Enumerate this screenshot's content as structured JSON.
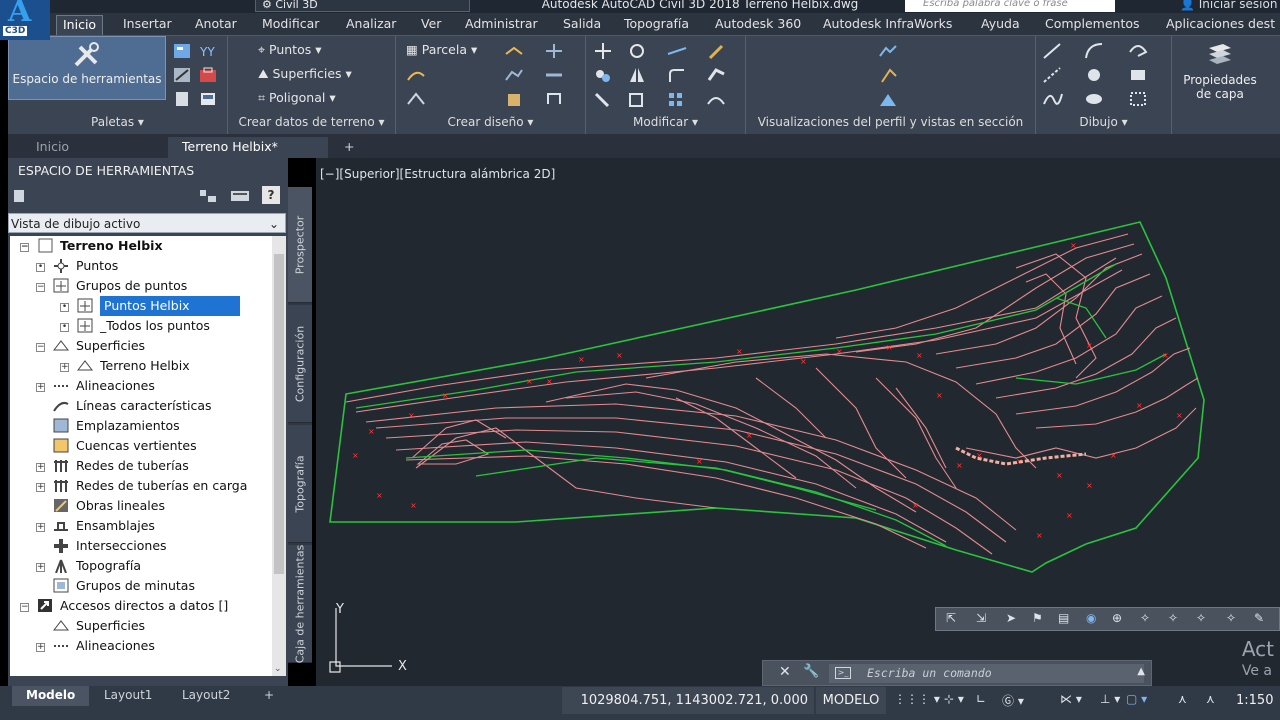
{
  "titlebar": {
    "workspace": "Civil 3D",
    "title": "Autodesk AutoCAD Civil 3D 2018     Terreno Helbix.dwg",
    "search_placeholder": "Escriba palabra clave o frase",
    "signin": "Iniciar sesión"
  },
  "app_badge": "C3D",
  "menu_tabs": [
    "Inicio",
    "Insertar",
    "Anotar",
    "Modificar",
    "Analizar",
    "Ver",
    "Administrar",
    "Salida",
    "Topografía",
    "Autodesk 360",
    "Autodesk InfraWorks",
    "Ayuda",
    "Complementos",
    "Aplicaciones dest"
  ],
  "ribbon": {
    "paletas": {
      "big_label": "Espacio de herramientas",
      "title": "Paletas"
    },
    "crear_datos": {
      "puntos": "Puntos",
      "superficies": "Superficies",
      "poligonal": "Poligonal",
      "title": "Crear datos de terreno"
    },
    "crear_diseno": {
      "parcela": "Parcela",
      "title": "Crear diseño"
    },
    "modificar": {
      "title": "Modificar"
    },
    "perfil": {
      "title": "Visualizaciones del perfil y vistas en sección"
    },
    "dibujo": {
      "title": "Dibujo"
    },
    "capas": {
      "label_1": "Propiedades",
      "label_2": "de capa"
    }
  },
  "doc_tabs": [
    "Inicio",
    "Terreno Helbix*",
    "+"
  ],
  "toolspace": {
    "header": "ESPACIO DE HERRAMIENTAS",
    "dropdown": "Vista de dibujo activo",
    "tree": [
      {
        "label": "Terreno Helbix",
        "bold": true
      },
      {
        "label": "Puntos"
      },
      {
        "label": "Grupos de puntos"
      },
      {
        "label": "Puntos Helbix",
        "selected": true
      },
      {
        "label": "_Todos los puntos"
      },
      {
        "label": "Superficies"
      },
      {
        "label": "Terreno Helbix"
      },
      {
        "label": "Alineaciones"
      },
      {
        "label": "Líneas características"
      },
      {
        "label": "Emplazamientos"
      },
      {
        "label": "Cuencas vertientes"
      },
      {
        "label": "Redes de tuberías"
      },
      {
        "label": "Redes de tuberías en carga"
      },
      {
        "label": "Obras lineales"
      },
      {
        "label": "Ensamblajes"
      },
      {
        "label": "Intersecciones"
      },
      {
        "label": "Topografía"
      },
      {
        "label": "Grupos de minutas"
      },
      {
        "label": "Accesos directos a datos []"
      },
      {
        "label": "Superficies"
      },
      {
        "label": "Alineaciones"
      }
    ],
    "vertical_tabs": [
      "Prospector",
      "Configuración",
      "Topografía",
      "Caja de herramientas"
    ]
  },
  "viewport": {
    "label": "[−][Superior][Estructura alámbrica 2D]",
    "ucs_x": "X",
    "ucs_y": "Y",
    "watermark_1": "Act",
    "watermark_2": "Ve a"
  },
  "command": {
    "placeholder": "Escriba un comando"
  },
  "status": {
    "layout_tabs": [
      "Modelo",
      "Layout1",
      "Layout2",
      "+"
    ],
    "coords": "1029804.751, 1143002.721, 0.000",
    "mode": "MODELO",
    "scale": "1:150"
  },
  "colors": {
    "contour": "#e48a8e",
    "boundary": "#28c43c",
    "points": "#ff3b3b",
    "accent": "#1e73d3"
  }
}
